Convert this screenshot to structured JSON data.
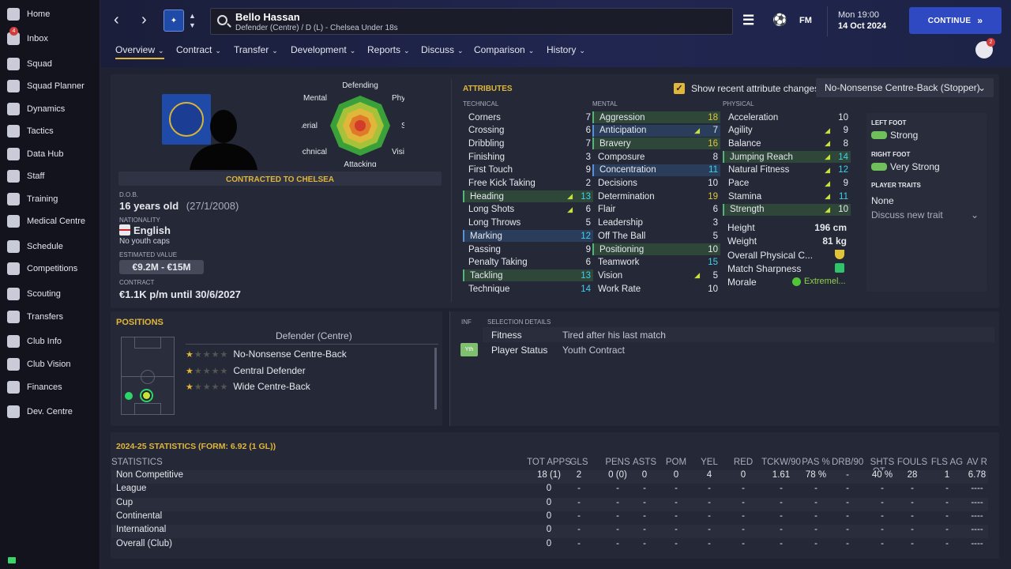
{
  "sidebar": [
    {
      "label": "Home",
      "icon": "home-icon"
    },
    {
      "label": "Inbox",
      "icon": "inbox-icon",
      "badge": "4"
    },
    {
      "label": "Squad",
      "icon": "squad-icon"
    },
    {
      "label": "Squad Planner",
      "icon": "planner-icon"
    },
    {
      "label": "Dynamics",
      "icon": "dynamics-icon"
    },
    {
      "label": "Tactics",
      "icon": "tactics-icon"
    },
    {
      "label": "Data Hub",
      "icon": "data-hub-icon"
    },
    {
      "label": "Staff",
      "icon": "staff-icon"
    },
    {
      "label": "Training",
      "icon": "training-icon"
    },
    {
      "label": "Medical Centre",
      "icon": "medical-icon"
    },
    {
      "label": "Schedule",
      "icon": "schedule-icon"
    },
    {
      "label": "Competitions",
      "icon": "trophy-icon"
    },
    {
      "label": "Scouting",
      "icon": "scouting-icon"
    },
    {
      "label": "Transfers",
      "icon": "transfers-icon"
    },
    {
      "label": "Club Info",
      "icon": "club-info-icon"
    },
    {
      "label": "Club Vision",
      "icon": "club-vision-icon"
    },
    {
      "label": "Finances",
      "icon": "finances-icon"
    },
    {
      "label": "Dev. Centre",
      "icon": "dev-centre-icon"
    }
  ],
  "header": {
    "name": "Bello Hassan",
    "sub": "Defender (Centre) / D (L) - Chelsea Under 18s",
    "fm": "FM",
    "time": "Mon 19:00",
    "date": "14 Oct 2024",
    "continue": "CONTINUE",
    "notif": "2"
  },
  "tabs": [
    "Overview",
    "Contract",
    "Transfer",
    "Development",
    "Reports",
    "Discuss",
    "Comparison",
    "History"
  ],
  "profile": {
    "contracted": "CONTRACTED TO CHELSEA",
    "dob_label": "D.O.B.",
    "age": "16 years old",
    "dob": "(27/1/2008)",
    "nat_label": "NATIONALITY",
    "nationality": "English",
    "caps": "No youth caps",
    "value_label": "ESTIMATED VALUE",
    "value": "€9.2M - €15M",
    "contract_label": "CONTRACT",
    "contract": "€1.1K p/m until 30/6/2027",
    "club_crest": "CHELSEA"
  },
  "radar": {
    "labels": [
      "Defending",
      "Physical",
      "Speed",
      "Vision",
      "Attacking",
      "Technical",
      "Aerial",
      "Mental"
    ]
  },
  "attributes": {
    "title": "ATTRIBUTES",
    "show_changes": "Show recent attribute changes",
    "role": "No-Nonsense Centre-Back (Stopper)",
    "technical_label": "TECHNICAL",
    "mental_label": "MENTAL",
    "physical_label": "PHYSICAL",
    "technical": [
      [
        "Corners",
        "7",
        ""
      ],
      [
        "Crossing",
        "6",
        ""
      ],
      [
        "Dribbling",
        "7",
        ""
      ],
      [
        "Finishing",
        "3",
        ""
      ],
      [
        "First Touch",
        "9",
        ""
      ],
      [
        "Free Kick Taking",
        "2",
        ""
      ],
      [
        "Heading",
        "13",
        "g"
      ],
      [
        "Long Shots",
        "6",
        ""
      ],
      [
        "Long Throws",
        "5",
        ""
      ],
      [
        "Marking",
        "12",
        "b"
      ],
      [
        "Passing",
        "9",
        ""
      ],
      [
        "Penalty Taking",
        "6",
        ""
      ],
      [
        "Tackling",
        "13",
        "g"
      ],
      [
        "Technique",
        "14",
        ""
      ]
    ],
    "mental": [
      [
        "Aggression",
        "18",
        "g"
      ],
      [
        "Anticipation",
        "7",
        "b"
      ],
      [
        "Bravery",
        "16",
        "g"
      ],
      [
        "Composure",
        "8",
        ""
      ],
      [
        "Concentration",
        "11",
        "b"
      ],
      [
        "Decisions",
        "10",
        ""
      ],
      [
        "Determination",
        "19",
        ""
      ],
      [
        "Flair",
        "6",
        ""
      ],
      [
        "Leadership",
        "3",
        ""
      ],
      [
        "Off The Ball",
        "5",
        ""
      ],
      [
        "Positioning",
        "10",
        "g"
      ],
      [
        "Teamwork",
        "15",
        ""
      ],
      [
        "Vision",
        "5",
        ""
      ],
      [
        "Work Rate",
        "10",
        ""
      ]
    ],
    "physical": [
      [
        "Acceleration",
        "10",
        ""
      ],
      [
        "Agility",
        "9",
        ""
      ],
      [
        "Balance",
        "8",
        ""
      ],
      [
        "Jumping Reach",
        "14",
        "g"
      ],
      [
        "Natural Fitness",
        "12",
        ""
      ],
      [
        "Pace",
        "9",
        ""
      ],
      [
        "Stamina",
        "11",
        ""
      ],
      [
        "Strength",
        "10",
        "g"
      ]
    ],
    "height_label": "Height",
    "height": "196 cm",
    "weight_label": "Weight",
    "weight": "81 kg",
    "opc_label": "Overall Physical C...",
    "sharp_label": "Match Sharpness",
    "morale_label": "Morale",
    "morale": "Extremel..."
  },
  "feet": {
    "left_label": "LEFT FOOT",
    "left": "Strong",
    "right_label": "RIGHT FOOT",
    "right": "Very Strong",
    "traits_label": "PLAYER TRAITS",
    "traits": "None",
    "discuss": "Discuss new trait"
  },
  "positions": {
    "title": "POSITIONS",
    "pos": "Defender (Centre)",
    "roles": [
      "No-Nonsense Centre-Back",
      "Central Defender",
      "Wide Centre-Back"
    ]
  },
  "selection": {
    "inf": "INF",
    "title": "SELECTION DETAILS",
    "fitness_label": "Fitness",
    "fitness": "Tired after his last match",
    "status_label": "Player Status",
    "status": "Youth Contract",
    "yth": "Yth"
  },
  "stats": {
    "title": "2024-25 STATISTICS (FORM: 6.92 (1 GL))",
    "headers": [
      "STATISTICS",
      "TOT APPS",
      "GLS",
      "PENS",
      "ASTS",
      "POM",
      "YEL",
      "RED",
      "TCKW/90",
      "PAS %",
      "DRB/90",
      "SHTS OT...",
      "FOULS",
      "FLS AG",
      "AV R"
    ],
    "rows": [
      [
        "Non Competitive",
        "18 (1)",
        "2",
        "0 (0)",
        "0",
        "0",
        "4",
        "0",
        "1.61",
        "78 %",
        "-",
        "40 %",
        "28",
        "1",
        "6.78"
      ],
      [
        "League",
        "0",
        "-",
        "-",
        "-",
        "-",
        "-",
        "-",
        "-",
        "-",
        "-",
        "-",
        "-",
        "-",
        "----"
      ],
      [
        "Cup",
        "0",
        "-",
        "-",
        "-",
        "-",
        "-",
        "-",
        "-",
        "-",
        "-",
        "-",
        "-",
        "-",
        "----"
      ],
      [
        "Continental",
        "0",
        "-",
        "-",
        "-",
        "-",
        "-",
        "-",
        "-",
        "-",
        "-",
        "-",
        "-",
        "-",
        "----"
      ],
      [
        "International",
        "0",
        "-",
        "-",
        "-",
        "-",
        "-",
        "-",
        "-",
        "-",
        "-",
        "-",
        "-",
        "-",
        "----"
      ],
      [
        "Overall (Club)",
        "0",
        "-",
        "-",
        "-",
        "-",
        "-",
        "-",
        "-",
        "-",
        "-",
        "-",
        "-",
        "-",
        "----"
      ]
    ]
  }
}
